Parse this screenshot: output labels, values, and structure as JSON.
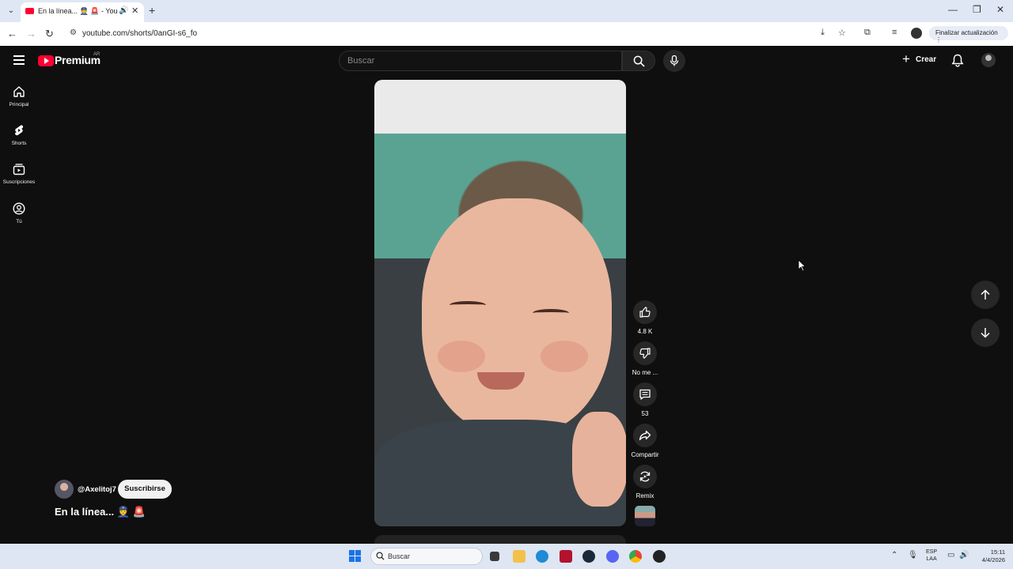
{
  "browser": {
    "tab_title": "En la línea... 👮 🚨 - YouTube",
    "url": "youtube.com/shorts/0anGI-s6_fo",
    "update_button": "Finalizar actualización"
  },
  "header": {
    "logo_text": "Premium",
    "logo_region": "AR",
    "search_placeholder": "Buscar",
    "create_label": "Crear"
  },
  "sidebar": {
    "items": [
      {
        "label": "Principal",
        "icon": "home-icon"
      },
      {
        "label": "Shorts",
        "icon": "shorts-icon"
      },
      {
        "label": "Suscripciones",
        "icon": "subscriptions-icon"
      },
      {
        "label": "Tú",
        "icon": "you-icon"
      }
    ]
  },
  "short": {
    "channel": "@Axelitoj7",
    "subscribe_label": "Suscribirse",
    "title": "En la línea... 👮 🚨",
    "actions": {
      "like_count": "4.8 K",
      "dislike_label": "No me ...",
      "comment_count": "53",
      "share_label": "Compartir",
      "remix_label": "Remix"
    }
  },
  "taskbar": {
    "search_label": "Buscar",
    "lang_1": "ESP",
    "lang_2": "LAA",
    "time": "15:11",
    "date": "4/4/2026"
  },
  "colors": {
    "background": "#0f0f0f",
    "youtube_red": "#ff0033",
    "button_bg": "#272727"
  }
}
